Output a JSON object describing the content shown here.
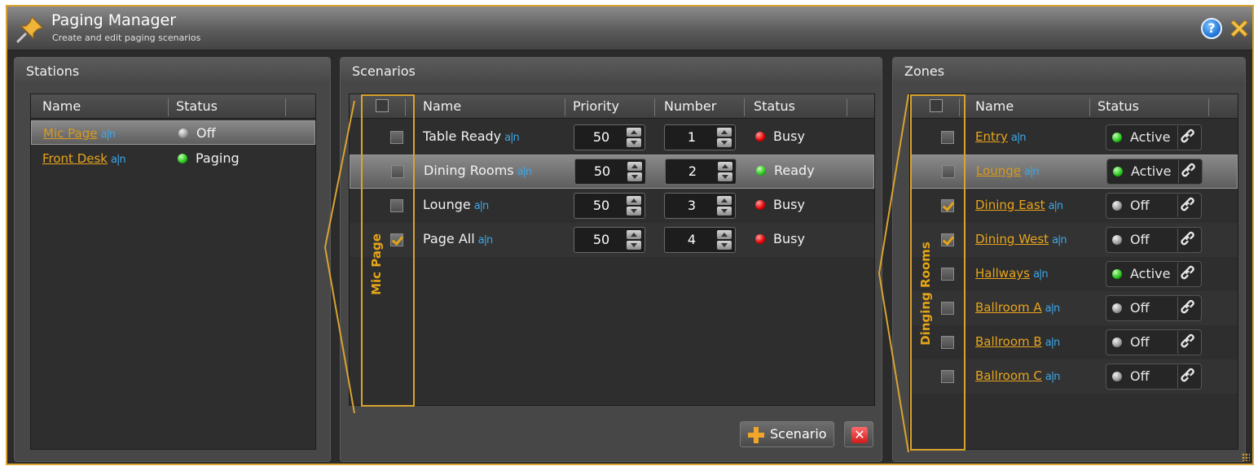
{
  "app": {
    "title": "Paging Manager",
    "subtitle": "Create and edit paging scenarios",
    "accent": "#d9a430"
  },
  "icons": {
    "app": "pushpin-icon",
    "help": "help-icon",
    "close": "close-icon",
    "link": "chain-link-icon",
    "rename": "rename-text-icon"
  },
  "stations": {
    "title": "Stations",
    "columns": [
      "Name",
      "Status"
    ],
    "rows": [
      {
        "name": "Mic Page",
        "status": "Off",
        "color": "grey",
        "selected": true
      },
      {
        "name": "Front Desk",
        "status": "Paging",
        "color": "green",
        "selected": false
      }
    ]
  },
  "scenarios": {
    "title": "Scenarios",
    "columns": [
      "Name",
      "Priority",
      "Number",
      "Status"
    ],
    "group_label": "Mic Page",
    "rows": [
      {
        "name": "Table Ready",
        "priority": "50",
        "number": "1",
        "status": "Busy",
        "color": "red",
        "checked": false,
        "selected": false
      },
      {
        "name": "Dining Rooms",
        "priority": "50",
        "number": "2",
        "status": "Ready",
        "color": "green",
        "checked": false,
        "selected": true
      },
      {
        "name": "Lounge",
        "priority": "50",
        "number": "3",
        "status": "Busy",
        "color": "red",
        "checked": false,
        "selected": false
      },
      {
        "name": "Page All",
        "priority": "50",
        "number": "4",
        "status": "Busy",
        "color": "red",
        "checked": true,
        "selected": false
      }
    ],
    "add_button": "Scenario",
    "delete_button": "✕"
  },
  "zones": {
    "title": "Zones",
    "columns": [
      "Name",
      "Status"
    ],
    "group_label": "Dinging Rooms",
    "rows": [
      {
        "name": "Entry",
        "status": "Active",
        "color": "green",
        "checked": false,
        "selected": false
      },
      {
        "name": "Lounge",
        "status": "Active",
        "color": "green",
        "checked": false,
        "selected": true
      },
      {
        "name": "Dining East",
        "status": "Off",
        "color": "grey",
        "checked": true,
        "selected": false
      },
      {
        "name": "Dining West",
        "status": "Off",
        "color": "grey",
        "checked": true,
        "selected": false
      },
      {
        "name": "Hallways",
        "status": "Active",
        "color": "green",
        "checked": false,
        "selected": false
      },
      {
        "name": "Ballroom A",
        "status": "Off",
        "color": "grey",
        "checked": false,
        "selected": false
      },
      {
        "name": "Ballroom B",
        "status": "Off",
        "color": "grey",
        "checked": false,
        "selected": false
      },
      {
        "name": "Ballroom C",
        "status": "Off",
        "color": "grey",
        "checked": false,
        "selected": false
      }
    ]
  }
}
